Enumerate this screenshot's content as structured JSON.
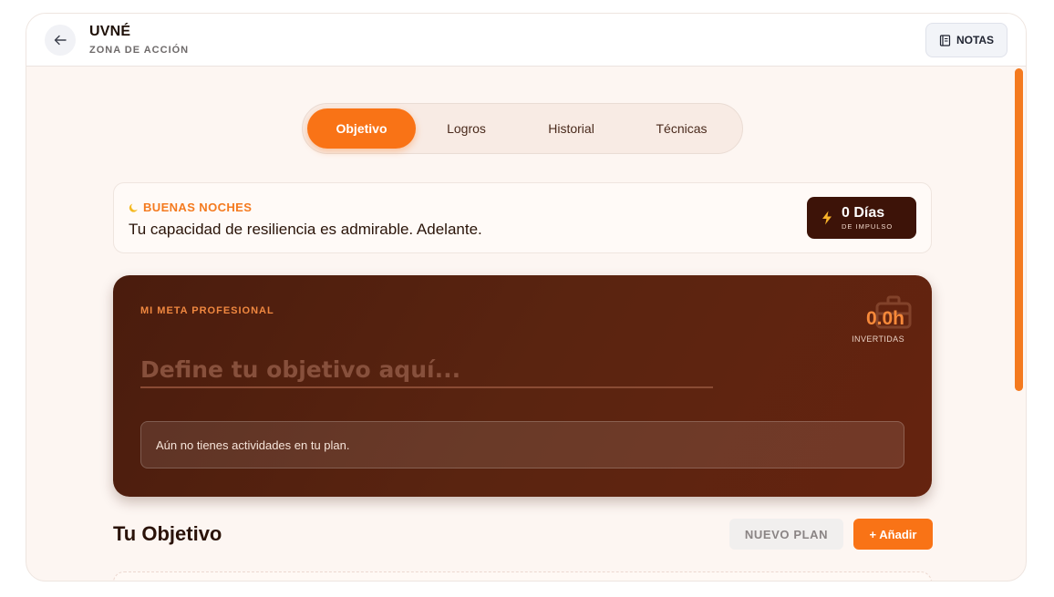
{
  "header": {
    "title": "UVNÉ",
    "subtitle": "ZONA DE ACCIÓN",
    "notes_label": "NOTAS"
  },
  "tabs": [
    {
      "label": "Objetivo",
      "active": true
    },
    {
      "label": "Logros",
      "active": false
    },
    {
      "label": "Historial",
      "active": false
    },
    {
      "label": "Técnicas",
      "active": false
    }
  ],
  "greeting": {
    "kicker": "BUENAS NOCHES",
    "message": "Tu capacidad de resiliencia es admirable. Adelante.",
    "streak_value": "0 Días",
    "streak_label": "DE IMPULSO"
  },
  "goal": {
    "kicker": "MI META PROFESIONAL",
    "hours_value": "0.0h",
    "hours_label": "INVERTIDAS",
    "input_placeholder": "Define tu objetivo aquí...",
    "empty_message": "Aún no tienes actividades en tu plan."
  },
  "section": {
    "title": "Tu Objetivo",
    "new_plan_label": "NUEVO PLAN",
    "add_label": "+ Añadir"
  },
  "colors": {
    "accent": "#f97316",
    "card_dark": "#4a1c0d",
    "background": "#fdf6f2"
  },
  "icons": [
    "arrow-left-icon",
    "notebook-icon",
    "moon-icon",
    "lightning-icon",
    "briefcase-icon"
  ]
}
